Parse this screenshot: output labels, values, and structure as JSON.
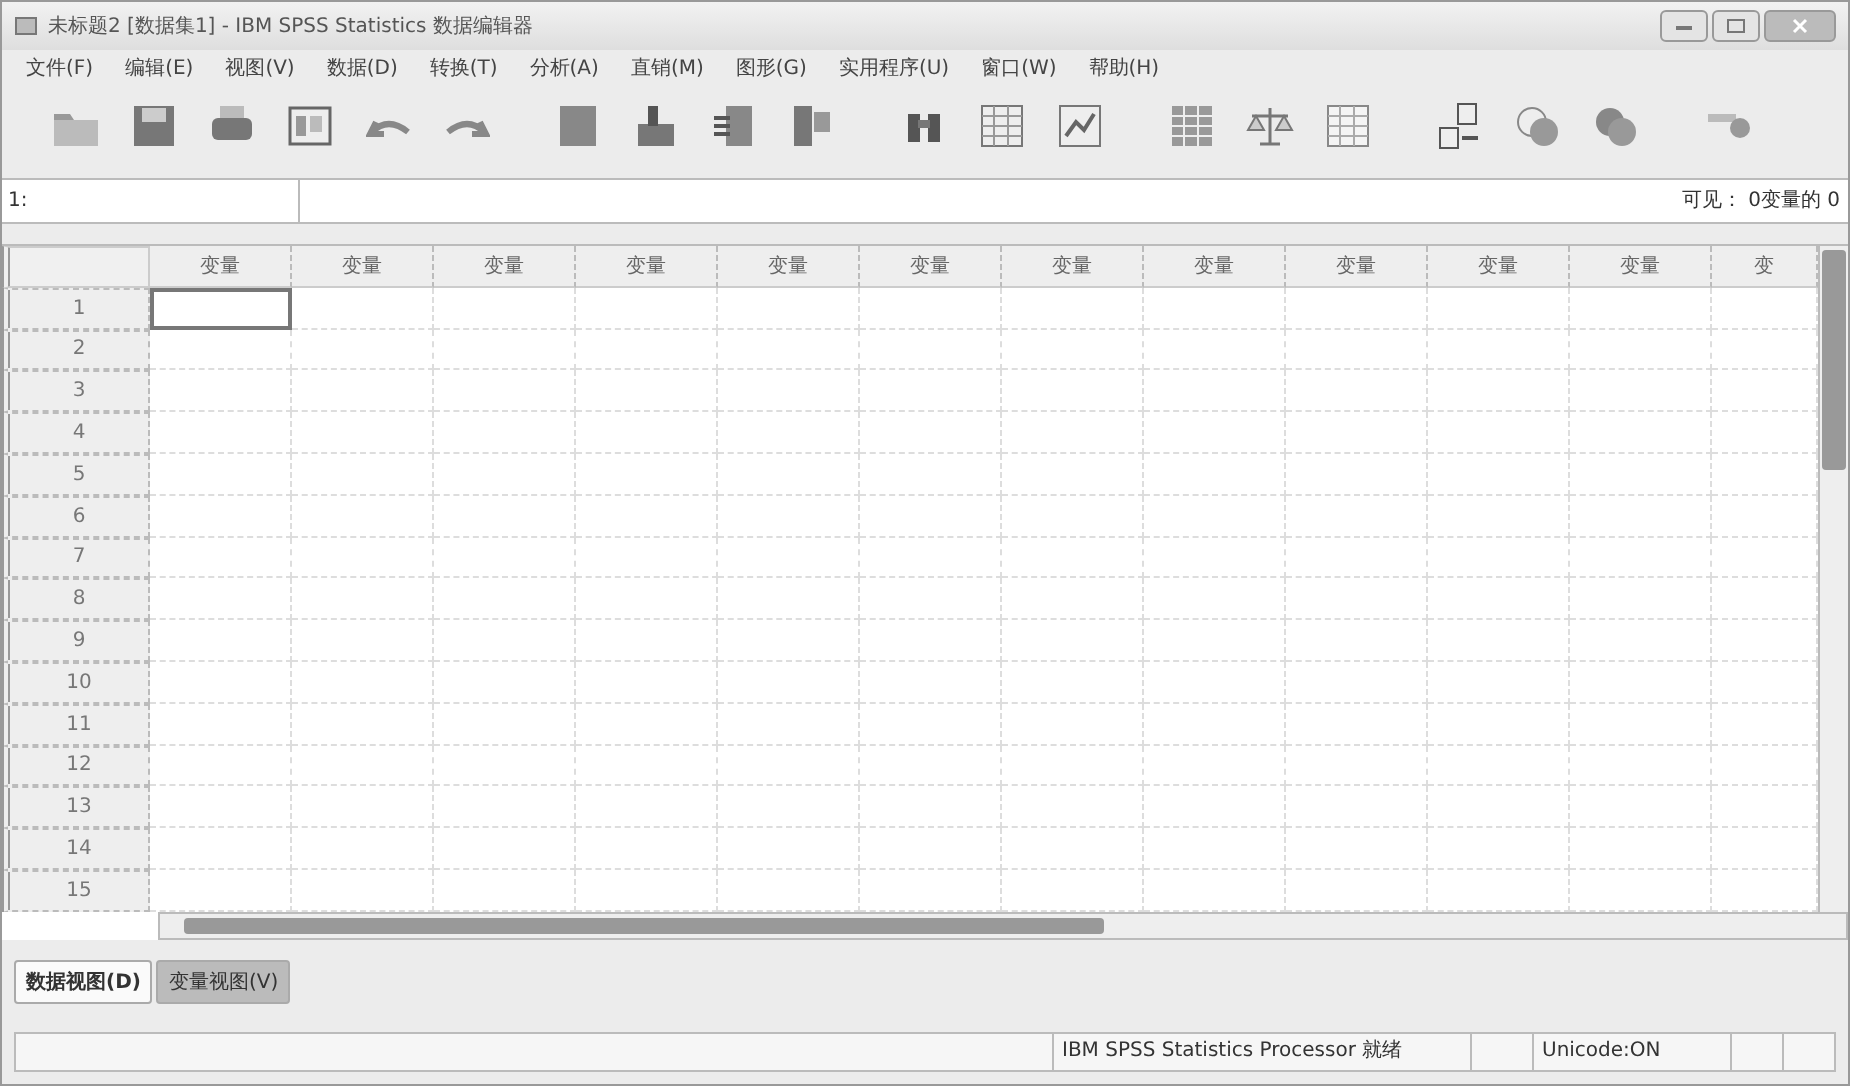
{
  "window": {
    "title": "未标题2 [数据集1] - IBM SPSS Statistics 数据编辑器"
  },
  "menu": [
    "文件(F)",
    "编辑(E)",
    "视图(V)",
    "数据(D)",
    "转换(T)",
    "分析(A)",
    "直销(M)",
    "图形(G)",
    "实用程序(U)",
    "窗口(W)",
    "帮助(H)"
  ],
  "cell_editor": {
    "cell_ref": "1:",
    "visible": "可见： 0变量的 0"
  },
  "grid": {
    "columns": [
      "变量",
      "变量",
      "变量",
      "变量",
      "变量",
      "变量",
      "变量",
      "变量",
      "变量",
      "变量",
      "变量",
      "变"
    ],
    "rows": [
      "1",
      "2",
      "3",
      "4",
      "5",
      "6",
      "7",
      "8",
      "9",
      "10",
      "11",
      "12",
      "13",
      "14",
      "15"
    ]
  },
  "tabs": [
    {
      "label": "数据视图(D)",
      "selected": true
    },
    {
      "label": "变量视图(V)",
      "selected": false
    }
  ],
  "status_bar": {
    "processor": "IBM SPSS Statistics Processor 就绪",
    "unicode": "Unicode:ON"
  }
}
